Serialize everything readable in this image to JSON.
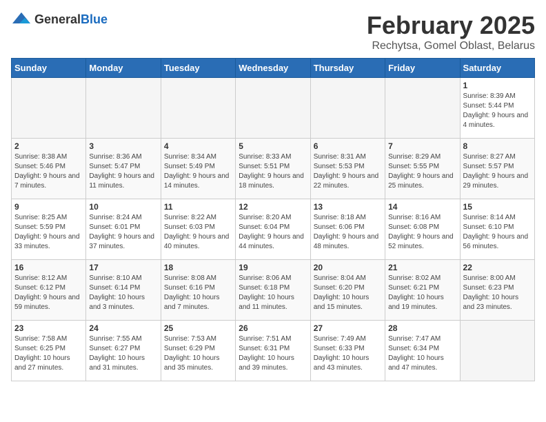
{
  "header": {
    "logo_general": "General",
    "logo_blue": "Blue",
    "month_title": "February 2025",
    "location": "Rechytsa, Gomel Oblast, Belarus"
  },
  "weekdays": [
    "Sunday",
    "Monday",
    "Tuesday",
    "Wednesday",
    "Thursday",
    "Friday",
    "Saturday"
  ],
  "weeks": [
    [
      {
        "day": "",
        "info": ""
      },
      {
        "day": "",
        "info": ""
      },
      {
        "day": "",
        "info": ""
      },
      {
        "day": "",
        "info": ""
      },
      {
        "day": "",
        "info": ""
      },
      {
        "day": "",
        "info": ""
      },
      {
        "day": "1",
        "info": "Sunrise: 8:39 AM\nSunset: 5:44 PM\nDaylight: 9 hours and 4 minutes."
      }
    ],
    [
      {
        "day": "2",
        "info": "Sunrise: 8:38 AM\nSunset: 5:46 PM\nDaylight: 9 hours and 7 minutes."
      },
      {
        "day": "3",
        "info": "Sunrise: 8:36 AM\nSunset: 5:47 PM\nDaylight: 9 hours and 11 minutes."
      },
      {
        "day": "4",
        "info": "Sunrise: 8:34 AM\nSunset: 5:49 PM\nDaylight: 9 hours and 14 minutes."
      },
      {
        "day": "5",
        "info": "Sunrise: 8:33 AM\nSunset: 5:51 PM\nDaylight: 9 hours and 18 minutes."
      },
      {
        "day": "6",
        "info": "Sunrise: 8:31 AM\nSunset: 5:53 PM\nDaylight: 9 hours and 22 minutes."
      },
      {
        "day": "7",
        "info": "Sunrise: 8:29 AM\nSunset: 5:55 PM\nDaylight: 9 hours and 25 minutes."
      },
      {
        "day": "8",
        "info": "Sunrise: 8:27 AM\nSunset: 5:57 PM\nDaylight: 9 hours and 29 minutes."
      }
    ],
    [
      {
        "day": "9",
        "info": "Sunrise: 8:25 AM\nSunset: 5:59 PM\nDaylight: 9 hours and 33 minutes."
      },
      {
        "day": "10",
        "info": "Sunrise: 8:24 AM\nSunset: 6:01 PM\nDaylight: 9 hours and 37 minutes."
      },
      {
        "day": "11",
        "info": "Sunrise: 8:22 AM\nSunset: 6:03 PM\nDaylight: 9 hours and 40 minutes."
      },
      {
        "day": "12",
        "info": "Sunrise: 8:20 AM\nSunset: 6:04 PM\nDaylight: 9 hours and 44 minutes."
      },
      {
        "day": "13",
        "info": "Sunrise: 8:18 AM\nSunset: 6:06 PM\nDaylight: 9 hours and 48 minutes."
      },
      {
        "day": "14",
        "info": "Sunrise: 8:16 AM\nSunset: 6:08 PM\nDaylight: 9 hours and 52 minutes."
      },
      {
        "day": "15",
        "info": "Sunrise: 8:14 AM\nSunset: 6:10 PM\nDaylight: 9 hours and 56 minutes."
      }
    ],
    [
      {
        "day": "16",
        "info": "Sunrise: 8:12 AM\nSunset: 6:12 PM\nDaylight: 9 hours and 59 minutes."
      },
      {
        "day": "17",
        "info": "Sunrise: 8:10 AM\nSunset: 6:14 PM\nDaylight: 10 hours and 3 minutes."
      },
      {
        "day": "18",
        "info": "Sunrise: 8:08 AM\nSunset: 6:16 PM\nDaylight: 10 hours and 7 minutes."
      },
      {
        "day": "19",
        "info": "Sunrise: 8:06 AM\nSunset: 6:18 PM\nDaylight: 10 hours and 11 minutes."
      },
      {
        "day": "20",
        "info": "Sunrise: 8:04 AM\nSunset: 6:20 PM\nDaylight: 10 hours and 15 minutes."
      },
      {
        "day": "21",
        "info": "Sunrise: 8:02 AM\nSunset: 6:21 PM\nDaylight: 10 hours and 19 minutes."
      },
      {
        "day": "22",
        "info": "Sunrise: 8:00 AM\nSunset: 6:23 PM\nDaylight: 10 hours and 23 minutes."
      }
    ],
    [
      {
        "day": "23",
        "info": "Sunrise: 7:58 AM\nSunset: 6:25 PM\nDaylight: 10 hours and 27 minutes."
      },
      {
        "day": "24",
        "info": "Sunrise: 7:55 AM\nSunset: 6:27 PM\nDaylight: 10 hours and 31 minutes."
      },
      {
        "day": "25",
        "info": "Sunrise: 7:53 AM\nSunset: 6:29 PM\nDaylight: 10 hours and 35 minutes."
      },
      {
        "day": "26",
        "info": "Sunrise: 7:51 AM\nSunset: 6:31 PM\nDaylight: 10 hours and 39 minutes."
      },
      {
        "day": "27",
        "info": "Sunrise: 7:49 AM\nSunset: 6:33 PM\nDaylight: 10 hours and 43 minutes."
      },
      {
        "day": "28",
        "info": "Sunrise: 7:47 AM\nSunset: 6:34 PM\nDaylight: 10 hours and 47 minutes."
      },
      {
        "day": "",
        "info": ""
      }
    ]
  ]
}
